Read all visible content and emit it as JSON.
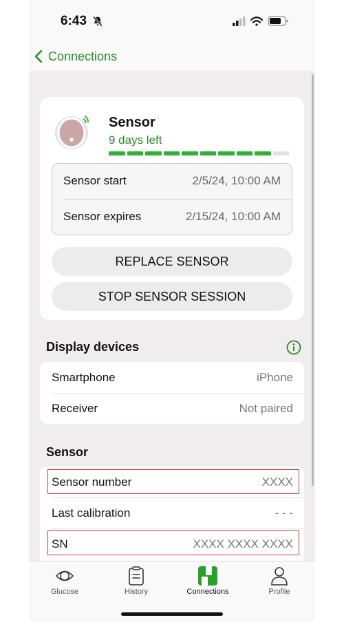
{
  "status": {
    "time": "6:43"
  },
  "nav": {
    "back_label": "Connections"
  },
  "sensor_card": {
    "title": "Sensor",
    "subtitle": "9 days left",
    "progress_filled_segments": 9,
    "progress_total_segments": 10,
    "rows": [
      {
        "label": "Sensor start",
        "value": "2/5/24, 10:00 AM"
      },
      {
        "label": "Sensor expires",
        "value": "2/15/24, 10:00 AM"
      }
    ],
    "replace_label": "REPLACE SENSOR",
    "stop_label": "STOP SENSOR SESSION"
  },
  "display_devices": {
    "heading": "Display devices",
    "rows": [
      {
        "label": "Smartphone",
        "value": "iPhone"
      },
      {
        "label": "Receiver",
        "value": "Not paired"
      }
    ]
  },
  "sensor_section": {
    "heading": "Sensor",
    "rows": [
      {
        "label": "Sensor number",
        "value": "XXXX"
      },
      {
        "label": "Last calibration",
        "value": "- - -"
      },
      {
        "label": "SN",
        "value": "XXXX XXXX XXXX"
      }
    ]
  },
  "tabs": [
    {
      "label": "Glucose",
      "icon": "glucose-icon"
    },
    {
      "label": "History",
      "icon": "history-icon"
    },
    {
      "label": "Connections",
      "icon": "connections-icon",
      "active": true
    },
    {
      "label": "Profile",
      "icon": "profile-icon"
    }
  ],
  "colors": {
    "accent": "#2a8a2a",
    "progress": "#33b033",
    "highlight": "#e03030"
  }
}
